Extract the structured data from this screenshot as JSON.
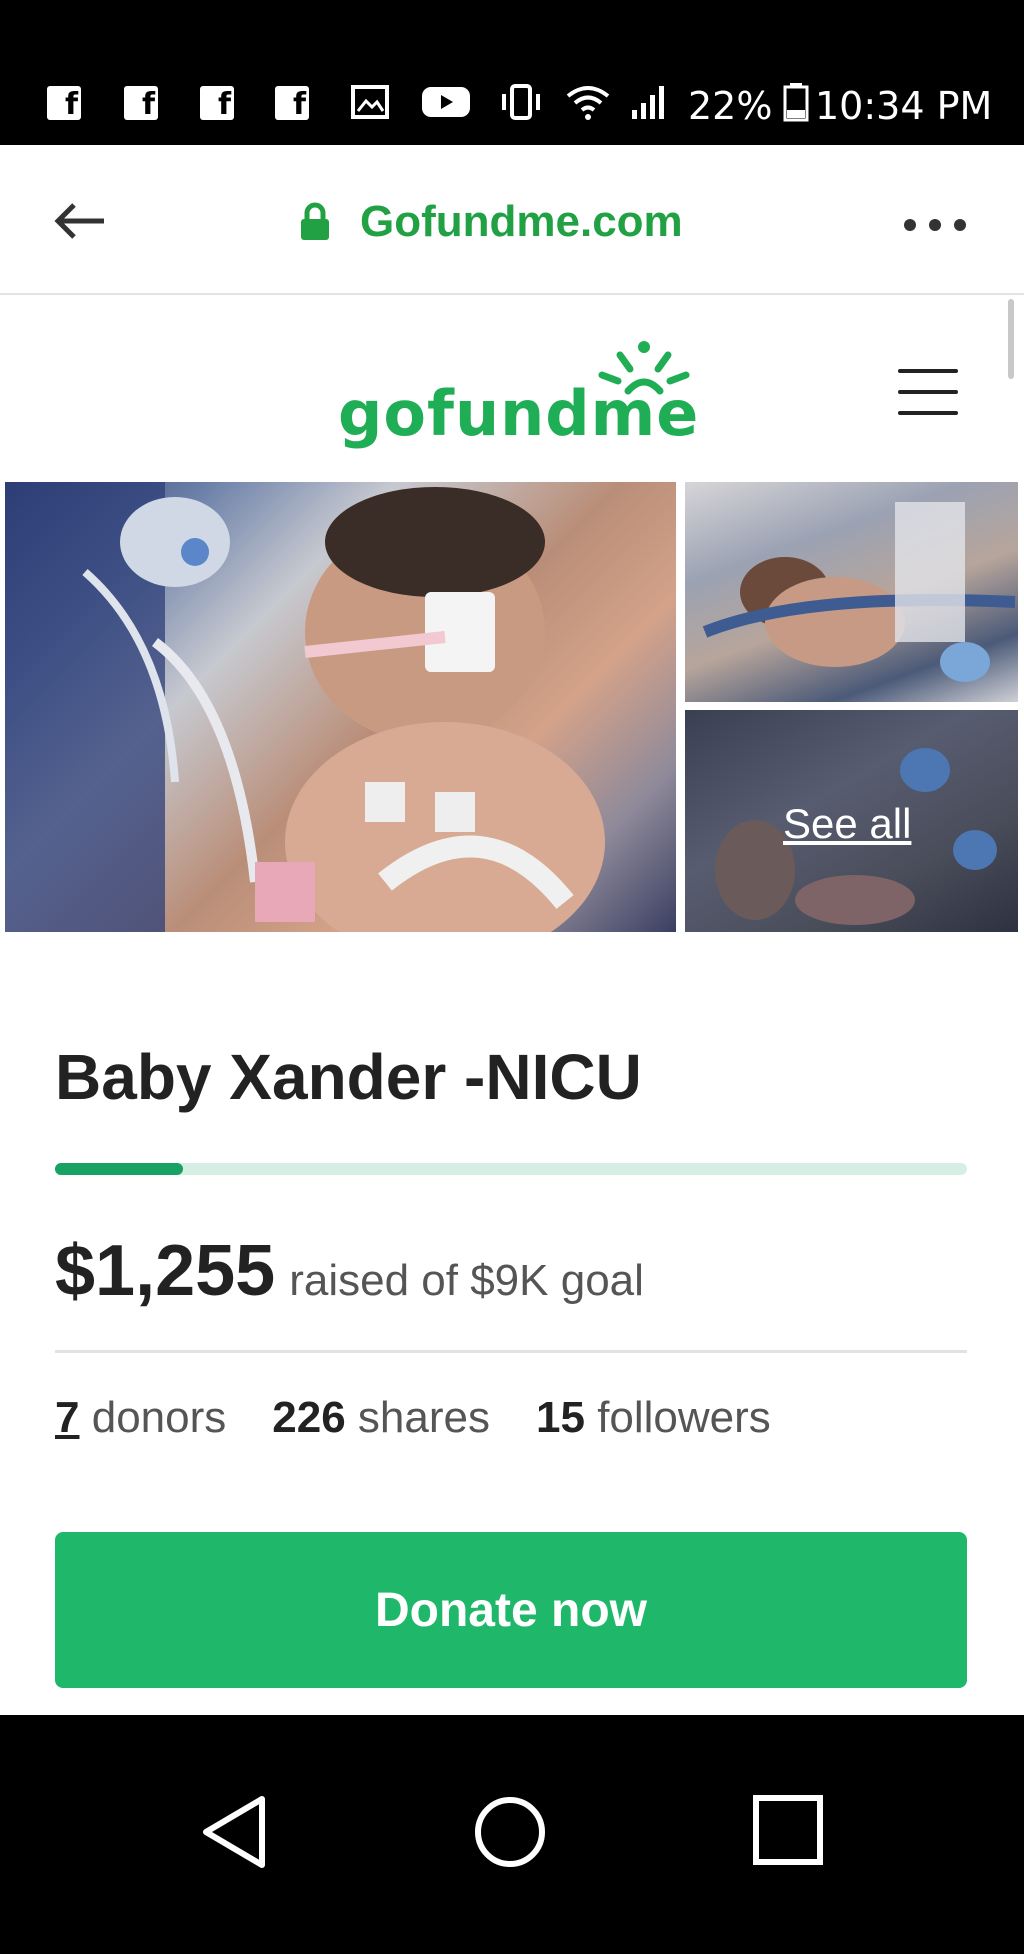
{
  "status_bar": {
    "notification_icons": [
      "facebook-icon",
      "facebook-icon",
      "facebook-icon",
      "facebook-icon",
      "image-icon",
      "youtube-icon",
      "vibrate-icon",
      "wifi-icon",
      "signal-icon"
    ],
    "battery_text": "22%",
    "time": "10:34 PM"
  },
  "browser": {
    "url": "Gofundme.com",
    "accent_color": "#21a144"
  },
  "site": {
    "logo_text": "gofundme",
    "brand_color": "#1fae56"
  },
  "gallery": {
    "see_all_label": "See all"
  },
  "campaign": {
    "title": "Baby Xander -NICU",
    "progress_fraction": 0.14,
    "amount_raised": "$1,255",
    "goal_text": "raised of $9K goal",
    "stats": {
      "donors_count": "7",
      "donors_label": "donors",
      "shares_count": "226",
      "shares_label": "shares",
      "followers_count": "15",
      "followers_label": "followers"
    },
    "donate_label": "Donate now",
    "donate_color": "#1fb86a"
  }
}
